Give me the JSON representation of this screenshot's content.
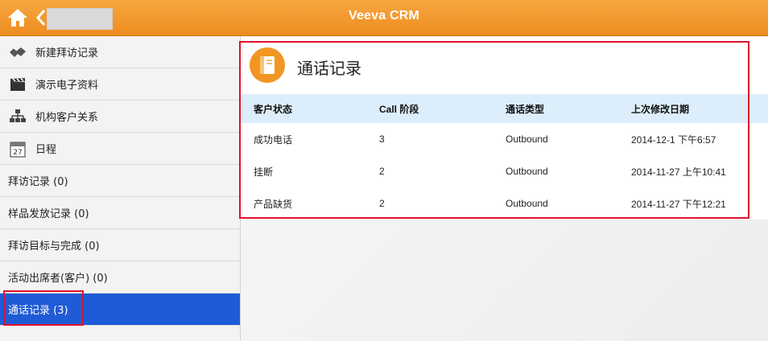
{
  "topbar": {
    "title": "Veeva CRM",
    "home_icon": "home-icon",
    "back_icon": "chevron-left-icon",
    "accent": "#ef8f1f"
  },
  "sidebar": {
    "items": [
      {
        "label": "新建拜访记录",
        "icon": "handshake-icon"
      },
      {
        "label": "演示电子资料",
        "icon": "clapperboard-icon"
      },
      {
        "label": "机构客户关系",
        "icon": "org-chart-icon"
      },
      {
        "label": "日程",
        "icon": "calendar-icon",
        "icon_text": "27"
      },
      {
        "label": "拜访记录 (0)"
      },
      {
        "label": "样品发放记录 (0)"
      },
      {
        "label": "拜访目标与完成 (0)"
      },
      {
        "label": "活动出席者(客户) (0)"
      },
      {
        "label": "通话记录 (3)",
        "selected": true
      }
    ],
    "selected_color": "#1f5bd6"
  },
  "main": {
    "section_title": "通话记录",
    "section_icon": "book-icon",
    "table": {
      "headers": [
        "客户状态",
        "Call 阶段",
        "通话类型",
        "上次修改日期"
      ],
      "rows": [
        [
          "成功电话",
          "3",
          "Outbound",
          "2014-12-1 下午6:57"
        ],
        [
          "挂断",
          "2",
          "Outbound",
          "2014-11-27 上午10:41"
        ],
        [
          "产品缺货",
          "2",
          "Outbound",
          "2014-11-27 下午12:21"
        ]
      ]
    }
  },
  "highlight_color": "#e0102a"
}
